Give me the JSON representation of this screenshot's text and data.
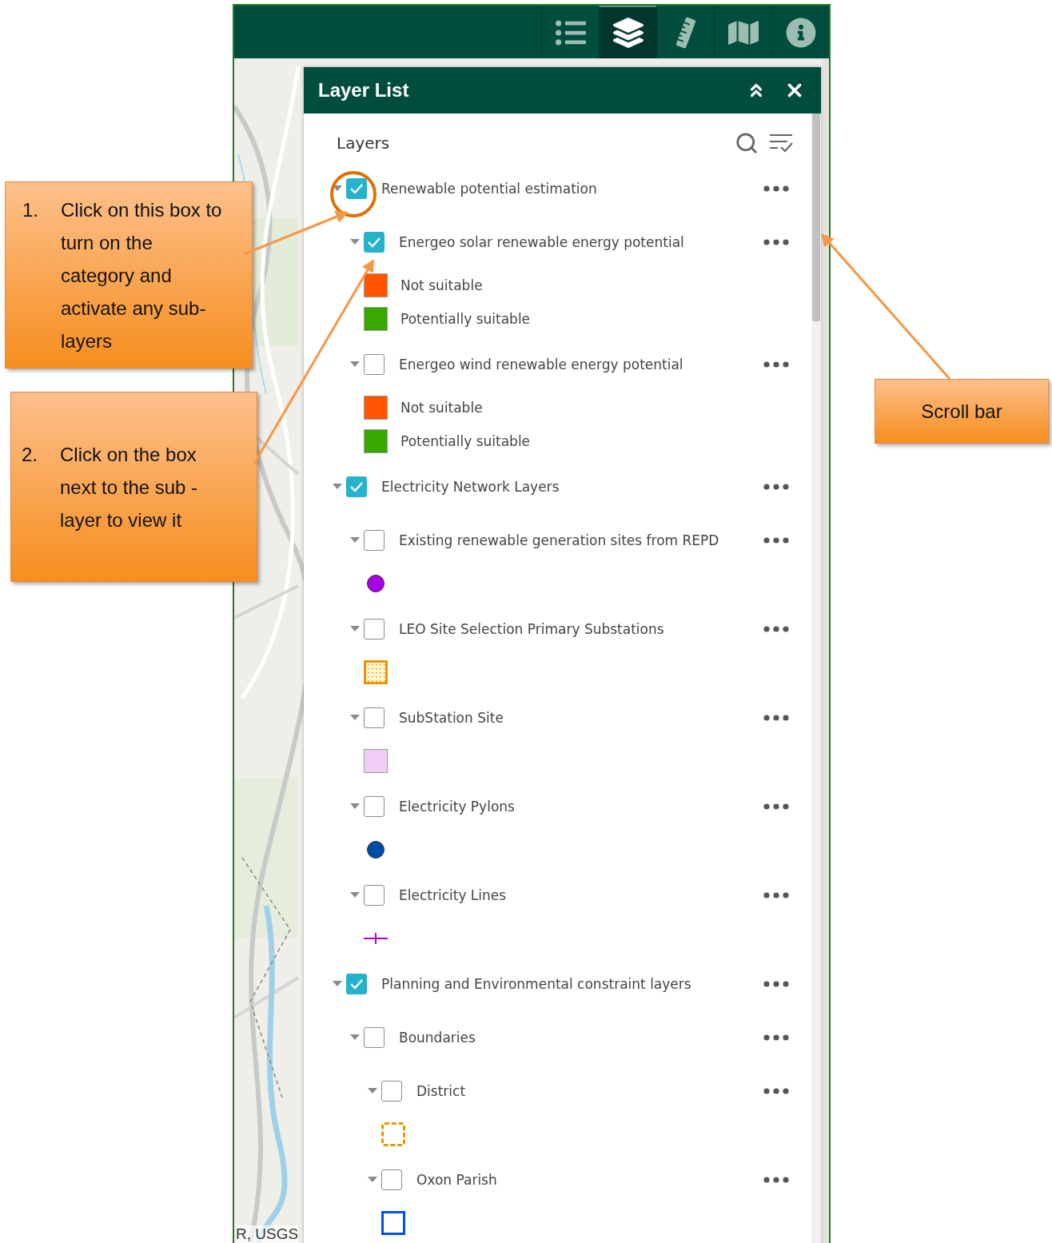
{
  "toolbar": {
    "tools": [
      {
        "kind": "legend",
        "selected": false
      },
      {
        "kind": "layers",
        "selected": true
      },
      {
        "kind": "measure",
        "selected": false
      },
      {
        "kind": "add-data",
        "selected": false
      },
      {
        "kind": "about",
        "selected": false
      }
    ]
  },
  "map": {
    "kind": "picture",
    "attribution": "R, USGS"
  },
  "panel": {
    "title": "Layer List",
    "heading": "Layers"
  },
  "layers": [
    {
      "label": "Renewable potential estimation",
      "checked": true,
      "expanded": true,
      "children": [
        {
          "label": "Energeo solar renewable energy potential",
          "checked": true,
          "expanded": true,
          "legend": [
            {
              "kind": "fill",
              "color": "#ff5500",
              "label": "Not suitable"
            },
            {
              "kind": "fill",
              "color": "#38a800",
              "label": "Potentially suitable"
            }
          ]
        },
        {
          "label": "Energeo wind renewable energy potential",
          "checked": false,
          "expanded": true,
          "legend": [
            {
              "kind": "fill",
              "color": "#ff5500",
              "label": "Not suitable"
            },
            {
              "kind": "fill",
              "color": "#38a800",
              "label": "Potentially suitable"
            }
          ]
        }
      ]
    },
    {
      "label": "Electricity Network Layers",
      "checked": true,
      "expanded": true,
      "children": [
        {
          "label": "Existing renewable generation sites from REPD",
          "checked": false,
          "expanded": true,
          "legend": [
            {
              "kind": "dot",
              "color": "#a900e6"
            }
          ]
        },
        {
          "label": "LEO Site Selection Primary Substations",
          "checked": false,
          "expanded": true,
          "legend": [
            {
              "kind": "dotted",
              "color": "#e69800"
            }
          ]
        },
        {
          "label": "SubStation Site",
          "checked": false,
          "expanded": true,
          "legend": [
            {
              "kind": "fill",
              "color": "#f0cdf5"
            }
          ]
        },
        {
          "label": "Electricity Pylons",
          "checked": false,
          "expanded": true,
          "legend": [
            {
              "kind": "dot",
              "color": "#004da8"
            }
          ]
        },
        {
          "label": "Electricity Lines",
          "checked": false,
          "expanded": true,
          "legend": [
            {
              "kind": "line",
              "color": "#a900e6"
            }
          ]
        }
      ]
    },
    {
      "label": "Planning and Environmental constraint layers",
      "checked": true,
      "expanded": true,
      "children": [
        {
          "label": "Boundaries",
          "checked": false,
          "expanded": true,
          "children": [
            {
              "label": "District",
              "checked": false,
              "expanded": true,
              "legend": [
                {
                  "kind": "dashed",
                  "color": "#e69800"
                }
              ]
            },
            {
              "label": "Oxon Parish",
              "checked": false,
              "expanded": true,
              "legend": [
                {
                  "kind": "outline",
                  "color": "#0050e6"
                }
              ]
            }
          ]
        }
      ]
    }
  ],
  "annotations": [
    {
      "number": "1.",
      "text": "Click on this box to turn on the category and activate any sub-layers"
    },
    {
      "number": "2.",
      "text": "Click on the box next to the sub -layer to view it"
    }
  ],
  "scroll_note": "Scroll bar"
}
